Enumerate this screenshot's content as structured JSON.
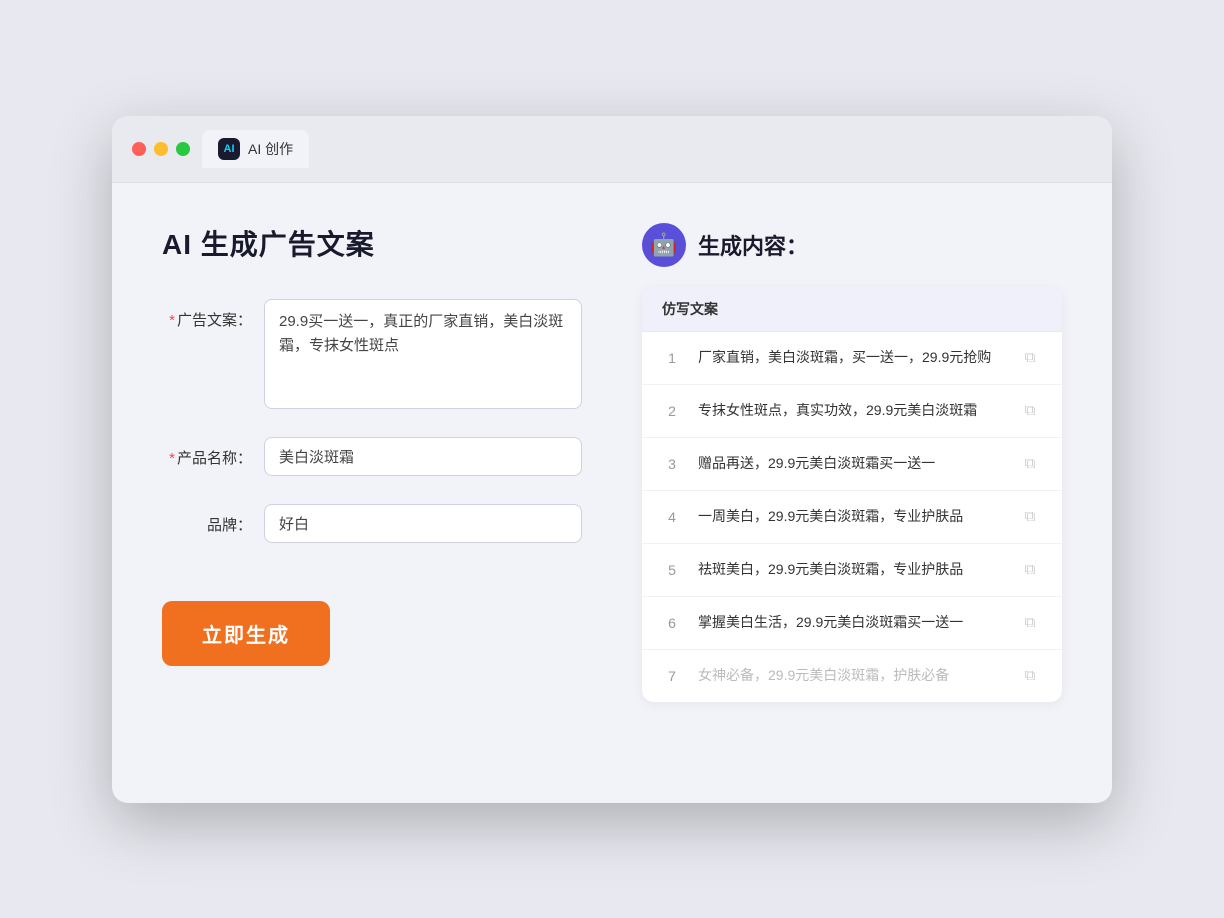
{
  "tab": {
    "label": "AI 创作",
    "icon": "AI"
  },
  "page": {
    "title": "AI 生成广告文案"
  },
  "form": {
    "ad_copy_label": "广告文案：",
    "ad_copy_required": true,
    "ad_copy_value": "29.9买一送一，真正的厂家直销，美白淡斑霜，专抹女性斑点",
    "product_name_label": "产品名称：",
    "product_name_required": true,
    "product_name_value": "美白淡斑霜",
    "brand_label": "品牌：",
    "brand_required": false,
    "brand_value": "好白",
    "generate_btn": "立即生成"
  },
  "result": {
    "header_icon": "robot",
    "header_title": "生成内容：",
    "table_header": "仿写文案",
    "rows": [
      {
        "num": 1,
        "text": "厂家直销，美白淡斑霜，买一送一，29.9元抢购",
        "faded": false
      },
      {
        "num": 2,
        "text": "专抹女性斑点，真实功效，29.9元美白淡斑霜",
        "faded": false
      },
      {
        "num": 3,
        "text": "赠品再送，29.9元美白淡斑霜买一送一",
        "faded": false
      },
      {
        "num": 4,
        "text": "一周美白，29.9元美白淡斑霜，专业护肤品",
        "faded": false
      },
      {
        "num": 5,
        "text": "祛斑美白，29.9元美白淡斑霜，专业护肤品",
        "faded": false
      },
      {
        "num": 6,
        "text": "掌握美白生活，29.9元美白淡斑霜买一送一",
        "faded": false
      },
      {
        "num": 7,
        "text": "女神必备，29.9元美白淡斑霜，护肤必备",
        "faded": true
      }
    ]
  },
  "colors": {
    "orange": "#f07020",
    "purple": "#5a4fd8",
    "accent": "#6b6bff"
  }
}
